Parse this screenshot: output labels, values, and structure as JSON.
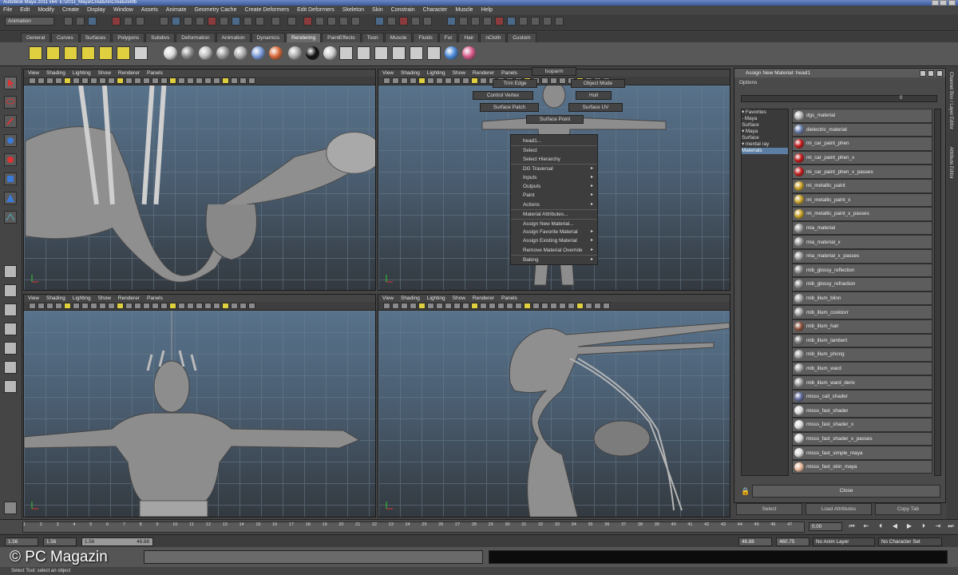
{
  "window": {
    "title": "Autodesk Maya 2011 x64: E:\\2011_Maya\\Creature\\CreatureMb"
  },
  "menubar": [
    "File",
    "Edit",
    "Modify",
    "Create",
    "Display",
    "Window",
    "Assets",
    "Animate",
    "Geometry Cache",
    "Create Deformers",
    "Edit Deformers",
    "Skeleton",
    "Skin",
    "Constrain",
    "Character",
    "Muscle",
    "Help"
  ],
  "statusline": {
    "mode": "Animation"
  },
  "shelf_tabs": [
    "General",
    "Curves",
    "Surfaces",
    "Polygons",
    "Subdivs",
    "Deformation",
    "Animation",
    "Dynamics",
    "Rendering",
    "PaintEffects",
    "Toon",
    "Muscle",
    "Fluids",
    "Fur",
    "Hair",
    "nCloth",
    "Custom"
  ],
  "shelf_active": "Rendering",
  "panel_menu": [
    "View",
    "Shading",
    "Lighting",
    "Show",
    "Renderer",
    "Panels"
  ],
  "marking_menu": {
    "north": "Isoparm",
    "nw": "Trim Edge",
    "ne": "Object Mode",
    "w": "Control Vertex",
    "e": "Hull",
    "sw": "Surface Patch",
    "se": "Surface UV",
    "s": "Surface Point"
  },
  "context_menu": [
    {
      "label": "head1...",
      "sub": false
    },
    {
      "label": "Select",
      "sub": false
    },
    {
      "label": "Select Hierarchy",
      "sub": false
    },
    {
      "label": "DG Traversal",
      "sub": true
    },
    {
      "label": "Inputs",
      "sub": true
    },
    {
      "label": "Outputs",
      "sub": true
    },
    {
      "label": "Paint",
      "sub": true
    },
    {
      "label": "Actions",
      "sub": true
    },
    {
      "label": "Material Attributes...",
      "sub": false
    },
    {
      "label": "Assign New Material...",
      "sub": false
    },
    {
      "label": "Assign Favorite Material",
      "sub": true
    },
    {
      "label": "Assign Existing Material",
      "sub": true
    },
    {
      "label": "Remove Material Override",
      "sub": true
    },
    {
      "label": "Baking",
      "sub": true
    }
  ],
  "material_window": {
    "title": "Assign New Material: head1",
    "options_label": "Options",
    "slider_value": "0",
    "tree": [
      {
        "label": "▾ Favorites",
        "sel": false
      },
      {
        "label": "  - Maya",
        "sel": false
      },
      {
        "label": "     Surface",
        "sel": false
      },
      {
        "label": "▾ Maya",
        "sel": false
      },
      {
        "label": "   Surface",
        "sel": false
      },
      {
        "label": "▾ mental ray",
        "sel": false
      },
      {
        "label": "   Materials",
        "sel": true
      }
    ],
    "materials": [
      {
        "name": "dgs_material",
        "color": "#b7b7b7"
      },
      {
        "name": "dielectric_material",
        "color": "#6b7fb0"
      },
      {
        "name": "mi_car_paint_phen",
        "color": "#c21a1a"
      },
      {
        "name": "mi_car_paint_phen_x",
        "color": "#c21a1a"
      },
      {
        "name": "mi_car_paint_phen_x_passes",
        "color": "#c21a1a"
      },
      {
        "name": "mi_metallic_paint",
        "color": "#c9a227"
      },
      {
        "name": "mi_metallic_paint_x",
        "color": "#c9a227"
      },
      {
        "name": "mi_metallic_paint_x_passes",
        "color": "#c9a227"
      },
      {
        "name": "mia_material",
        "color": "#9b9b9b"
      },
      {
        "name": "mia_material_x",
        "color": "#9b9b9b"
      },
      {
        "name": "mia_material_x_passes",
        "color": "#9b9b9b"
      },
      {
        "name": "mib_glossy_reflection",
        "color": "#888888"
      },
      {
        "name": "mib_glossy_refraction",
        "color": "#888888"
      },
      {
        "name": "mib_illum_blinn",
        "color": "#a0a0a0"
      },
      {
        "name": "mib_illum_cooktorr",
        "color": "#a0a0a0"
      },
      {
        "name": "mib_illum_hair",
        "color": "#8a4f3a"
      },
      {
        "name": "mib_illum_lambert",
        "color": "#7b7b7b"
      },
      {
        "name": "mib_illum_phong",
        "color": "#a0a0a0"
      },
      {
        "name": "mib_illum_ward",
        "color": "#a0a0a0"
      },
      {
        "name": "mib_illum_ward_deriv",
        "color": "#a0a0a0"
      },
      {
        "name": "misss_call_shader",
        "color": "#606a9a"
      },
      {
        "name": "misss_fast_shader",
        "color": "#d8d8d8"
      },
      {
        "name": "misss_fast_shader_x",
        "color": "#d8d8d8"
      },
      {
        "name": "misss_fast_shader_x_passes",
        "color": "#d8d8d8"
      },
      {
        "name": "misss_fast_simple_maya",
        "color": "#d8d8d8"
      },
      {
        "name": "misss_fast_skin_maya",
        "color": "#e8b89a"
      }
    ],
    "close_label": "Close"
  },
  "attr_buttons": [
    "Select",
    "Load Attributes",
    "Copy Tab"
  ],
  "right_tabs": [
    "Channel Box / Layer Editor",
    "Attribute Editor"
  ],
  "timeline": {
    "ticks": [
      "1",
      "2",
      "3",
      "4",
      "5",
      "6",
      "7",
      "8",
      "9",
      "10",
      "11",
      "12",
      "13",
      "14",
      "15",
      "16",
      "17",
      "18",
      "19",
      "20",
      "21",
      "22",
      "23",
      "24",
      "25",
      "26",
      "27",
      "28",
      "29",
      "30",
      "31",
      "32",
      "33",
      "34",
      "35",
      "36",
      "37",
      "38",
      "39",
      "40",
      "41",
      "42",
      "43",
      "44",
      "45",
      "46",
      "47"
    ],
    "current_time": "0.00"
  },
  "range": {
    "start": "1.56",
    "playback_start": "1.56",
    "range_start": "1.56",
    "range_end": "46.88",
    "playback_end": "46.88",
    "end": "460.75",
    "anim_layer": "No Anim Layer",
    "character_set": "No Character Set"
  },
  "help_line": "Select Tool: select an object",
  "watermark": "© PC Magazin"
}
